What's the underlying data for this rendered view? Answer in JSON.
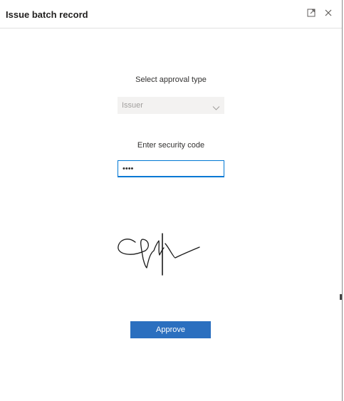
{
  "dialog": {
    "title": "Issue batch record",
    "icons": {
      "expand": "expand-icon",
      "close": "close-icon"
    }
  },
  "form": {
    "approval_type_label": "Select approval type",
    "approval_type_value": "Issuer",
    "security_code_label": "Enter security code",
    "security_code_value": "••••",
    "signature": "signature-image",
    "approve_label": "Approve"
  },
  "colors": {
    "accent": "#0078d4",
    "button": "#2b6fbf",
    "select_bg": "#f3f2f1"
  }
}
